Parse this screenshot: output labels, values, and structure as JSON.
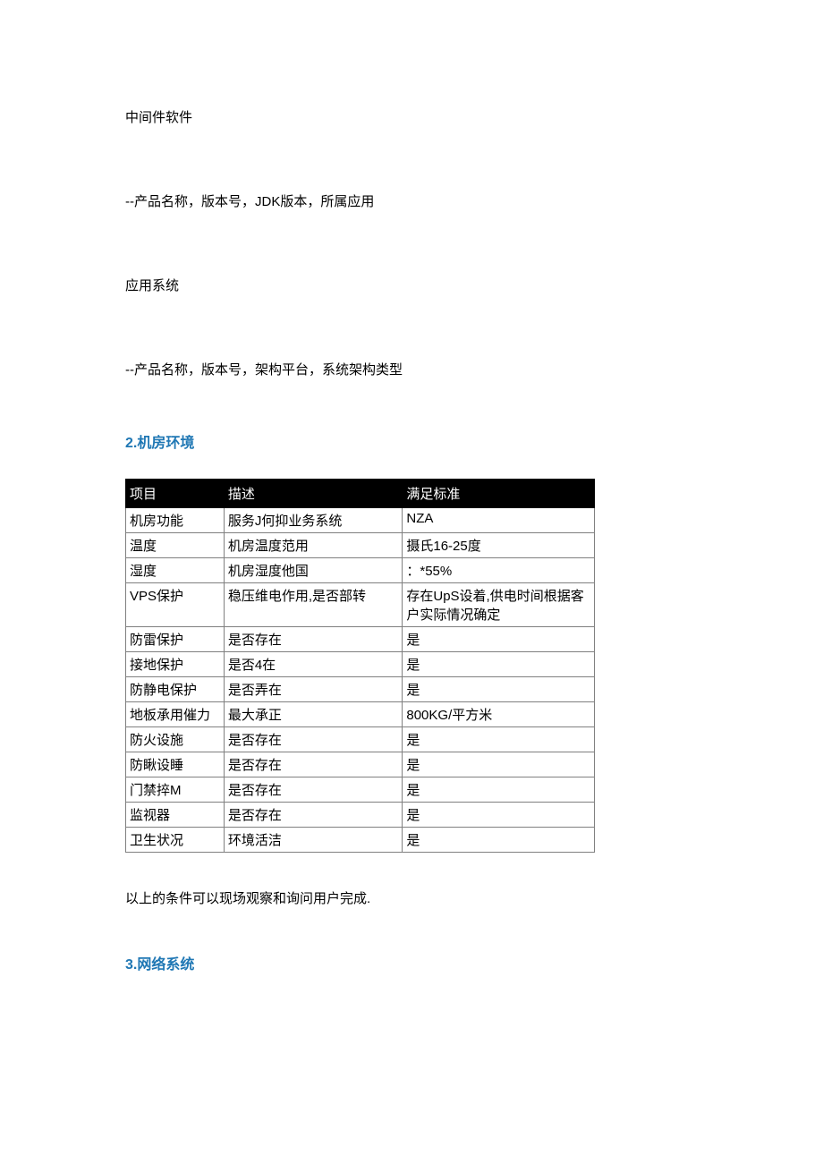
{
  "paragraphs": {
    "p1": "中间件软件",
    "p2": "--产品名称，版本号，JDK版本，所属应用",
    "p3": "应用系统",
    "p4": "--产品名称，版本号，架构平台，系统架构类型"
  },
  "section2": {
    "heading": "2.机房环境",
    "table": {
      "headers": [
        "项目",
        "描述",
        "满足标准"
      ],
      "rows": [
        [
          "机房功能",
          "服务J何抑业务系统",
          "NZA"
        ],
        [
          "温度",
          "机房温度范用",
          "摄氏16-25度"
        ],
        [
          "湿度",
          "机房湿度他国",
          "：*55%"
        ],
        [
          "VPS保护",
          "稳压维电作用,是否部转",
          "存在UpS设着,供电时间根据客户实际情况确定"
        ],
        [
          "防雷保护",
          "是否存在",
          "是"
        ],
        [
          "接地保护",
          "是否4在",
          "是"
        ],
        [
          "防静电保护",
          "是否弄在",
          "是"
        ],
        [
          "地板承用催力",
          "最大承正",
          "800KG/平方米"
        ],
        [
          "防火设施",
          "是否存在",
          "是"
        ],
        [
          "防瞅设睡",
          "是否存在",
          "是"
        ],
        [
          "门禁捽M",
          "是否存在",
          "是"
        ],
        [
          "监视器",
          "是否存在",
          "是"
        ],
        [
          "卫生状况",
          "环境活洁",
          "是"
        ]
      ]
    },
    "note": "以上的条件可以现场观察和询问用户完成."
  },
  "section3": {
    "heading": "3.网络系统"
  }
}
